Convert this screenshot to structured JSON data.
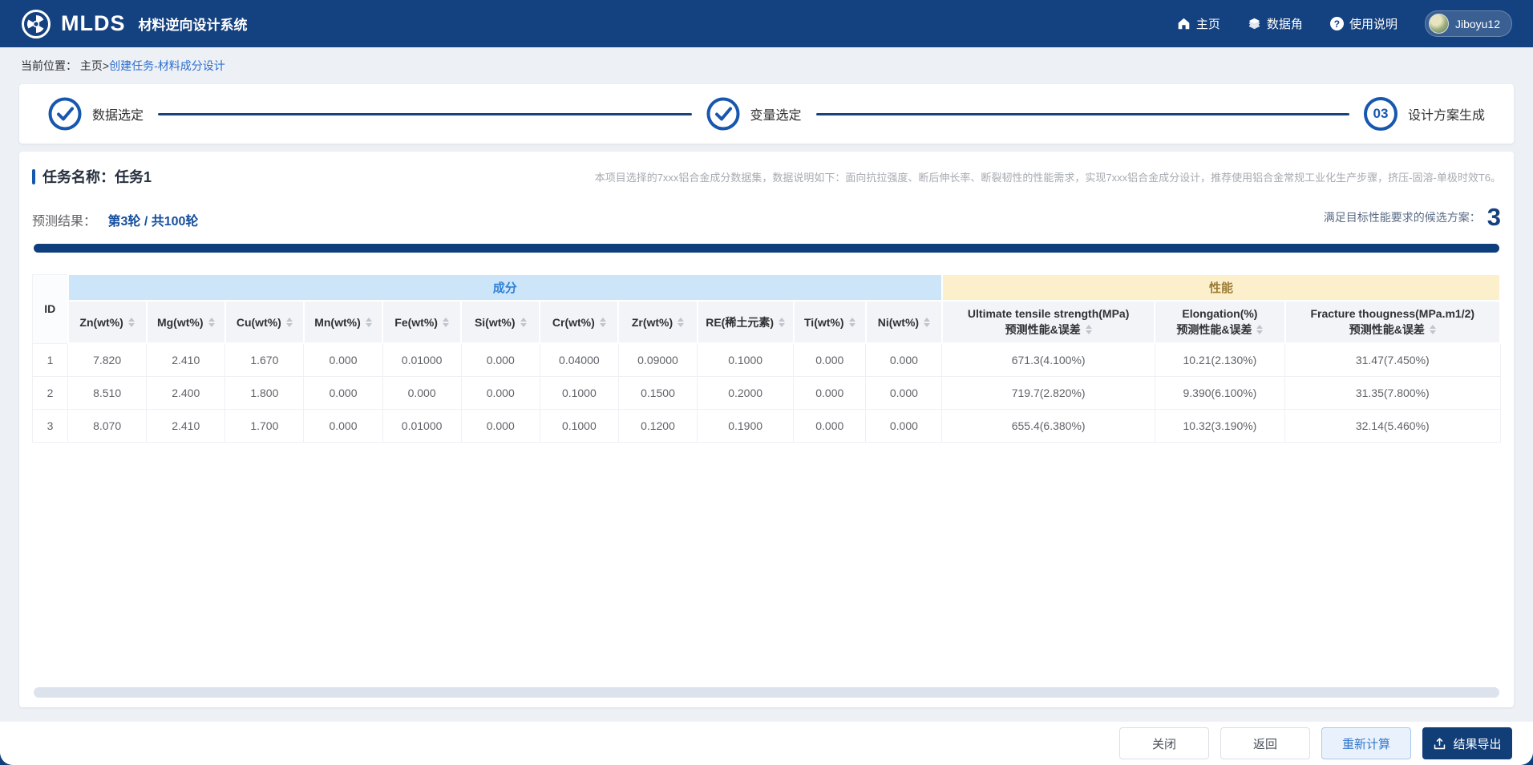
{
  "navbar": {
    "logo_text": "MLDS",
    "system_name": "材料逆向设计系统",
    "menu": [
      {
        "label": "主页",
        "icon": "home-icon"
      },
      {
        "label": "数据角",
        "icon": "layers-icon"
      },
      {
        "label": "使用说明",
        "icon": "help-icon"
      }
    ],
    "user": "Jiboyu12"
  },
  "breadcrumb": {
    "prefix": "当前位置：",
    "home": "主页>",
    "current": "创建任务-材料成分设计"
  },
  "steps": [
    {
      "label": "数据选定",
      "status": "done"
    },
    {
      "label": "变量选定",
      "status": "done"
    },
    {
      "label": "设计方案生成",
      "status": "current",
      "number": "03"
    }
  ],
  "task": {
    "name_label": "任务名称：任务1",
    "description": "本项目选择的7xxx铝合金成分数据集，数据说明如下：面向抗拉强度、断后伸长率、断裂韧性的性能需求，实现7xxx铝合金成分设计，推荐使用铝合金常规工业化生产步骤，挤压-固溶-单极时效T6。",
    "result_label": "预测结果：",
    "round_info": "第3轮 / 共100轮",
    "candidate_label": "满足目标性能要求的候选方案：",
    "candidate_count": "3",
    "progress_percent": 100
  },
  "table": {
    "id_header": "ID",
    "groups": {
      "composition": "成分",
      "performance": "性能"
    },
    "composition_columns": [
      "Zn(wt%)",
      "Mg(wt%)",
      "Cu(wt%)",
      "Mn(wt%)",
      "Fe(wt%)",
      "Si(wt%)",
      "Cr(wt%)",
      "Zr(wt%)",
      "RE(稀土元素)",
      "Ti(wt%)",
      "Ni(wt%)"
    ],
    "performance_columns": [
      {
        "line1": "Ultimate tensile strength(MPa)",
        "line2": "预测性能&误差"
      },
      {
        "line1": "Elongation(%)",
        "line2": "预测性能&误差"
      },
      {
        "line1": "Fracture thougness(MPa.m1/2)",
        "line2": "预测性能&误差"
      }
    ],
    "rows": [
      {
        "id": "1",
        "composition": [
          "7.820",
          "2.410",
          "1.670",
          "0.000",
          "0.01000",
          "0.000",
          "0.04000",
          "0.09000",
          "0.1000",
          "0.000",
          "0.000"
        ],
        "performance": [
          "671.3(4.100%)",
          "10.21(2.130%)",
          "31.47(7.450%)"
        ]
      },
      {
        "id": "2",
        "composition": [
          "8.510",
          "2.400",
          "1.800",
          "0.000",
          "0.000",
          "0.000",
          "0.1000",
          "0.1500",
          "0.2000",
          "0.000",
          "0.000"
        ],
        "performance": [
          "719.7(2.820%)",
          "9.390(6.100%)",
          "31.35(7.800%)"
        ]
      },
      {
        "id": "3",
        "composition": [
          "8.070",
          "2.410",
          "1.700",
          "0.000",
          "0.01000",
          "0.000",
          "0.1000",
          "0.1200",
          "0.1900",
          "0.000",
          "0.000"
        ],
        "performance": [
          "655.4(6.380%)",
          "10.32(3.190%)",
          "32.14(5.460%)"
        ]
      }
    ]
  },
  "footer": {
    "close": "关闭",
    "back": "返回",
    "recalculate": "重新计算",
    "export": "结果导出"
  },
  "colors": {
    "navbar_blue": "#14417f",
    "accent_blue": "#1757ae",
    "link_blue": "#2b6fce",
    "composition_header_bg": "#cde5f9",
    "composition_header_text": "#3181d8",
    "performance_header_bg": "#fcf0cc",
    "performance_header_text": "#9b7b35",
    "progress_bar": "#0e3e7b",
    "export_button_bg": "#123e78"
  }
}
